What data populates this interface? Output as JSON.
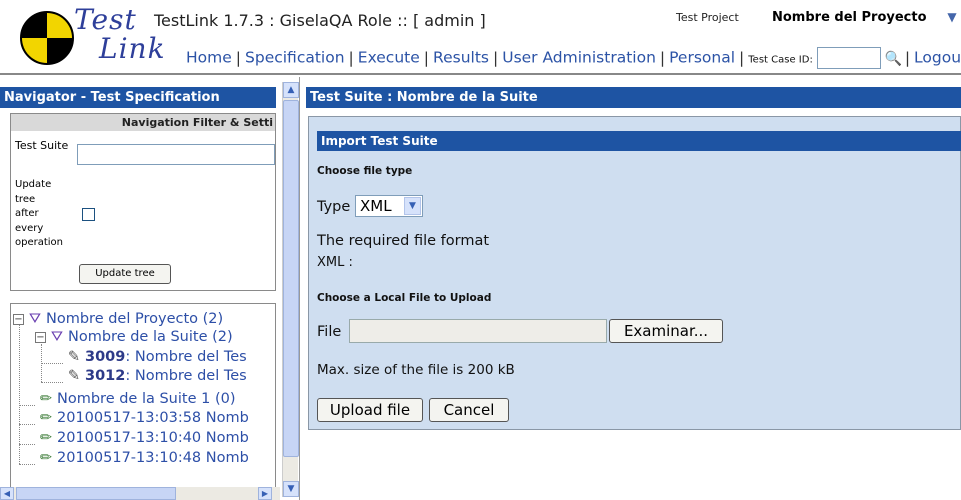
{
  "header": {
    "logo_test": "Test",
    "logo_link": "Link",
    "app_title": "TestLink 1.7.3 : GiselaQA Role :: [ admin ]",
    "test_project_label": "Test Project",
    "test_project_name": "Nombre del Proyecto",
    "menu": [
      "Home",
      "Specification",
      "Execute",
      "Results",
      "User Administration",
      "Personal"
    ],
    "test_case_id_label": "Test Case ID:",
    "test_case_id_value": "",
    "logout": "Logou"
  },
  "navigator": {
    "title": "Navigator - Test Specification",
    "filter_title": "Navigation Filter & Setti",
    "test_suite_label": "Test Suite",
    "test_suite_value": "",
    "update_label": "Update tree after every operation",
    "update_label_lines": [
      "Update",
      "tree",
      "after",
      "every",
      "operation"
    ],
    "update_checked": false,
    "update_button": "Update tree",
    "tree": {
      "project": "Nombre del Proyecto (2)",
      "suite": "Nombre de la Suite (2)",
      "cases": [
        {
          "id": "3009",
          "name": ": Nombre del Tes"
        },
        {
          "id": "3012",
          "name": ": Nombre del Tes"
        }
      ],
      "other_nodes": [
        "Nombre de la Suite 1 (0)",
        "20100517-13:03:58 Nomb",
        "20100517-13:10:40 Nomb",
        "20100517-13:10:48 Nomb"
      ]
    }
  },
  "main": {
    "title": "Test Suite : Nombre de la Suite",
    "import_title": "Import Test Suite",
    "choose_file_type": "Choose file type",
    "type_label": "Type",
    "type_value": "XML",
    "format_text": "The required file format",
    "format_value": "XML :",
    "choose_local_file": "Choose a Local File to Upload",
    "file_label": "File",
    "file_value": "",
    "browse_button": "Examinar...",
    "max_size": "Max. size of the file is 200 kB",
    "upload_button": "Upload file",
    "cancel_button": "Cancel"
  },
  "colors": {
    "title_bar": "#1e54a3",
    "panel_bg": "#cfdef0",
    "link": "#2c53a6"
  }
}
